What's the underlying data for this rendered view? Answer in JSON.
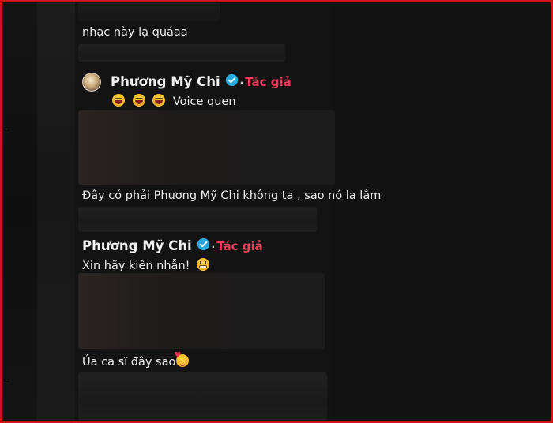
{
  "comments": [
    {
      "text": "nhạc này lạ quáaa"
    },
    {
      "author": "Phương Mỹ Chi",
      "author_badge": "Tác giả",
      "separator": "·",
      "text": "Voice quen",
      "emoji": [
        "laughing",
        "laughing",
        "laughing"
      ]
    },
    {
      "text": "Đây có phải Phương Mỹ Chi không ta , sao nó lạ lắm"
    },
    {
      "author": "Phương Mỹ Chi",
      "author_badge": "Tác giả",
      "separator": "·",
      "text": "Xin hãy kiên nhẫn!",
      "emoji": [
        "grimacing"
      ]
    },
    {
      "text": "Ủa ca sĩ đây sao",
      "emoji": [
        "smiling-face-with-hearts"
      ]
    }
  ],
  "colors": {
    "author_badge": "#ff3b5c",
    "verified": "#27a8e0",
    "frame": "#d4141b",
    "background": "#131313"
  }
}
